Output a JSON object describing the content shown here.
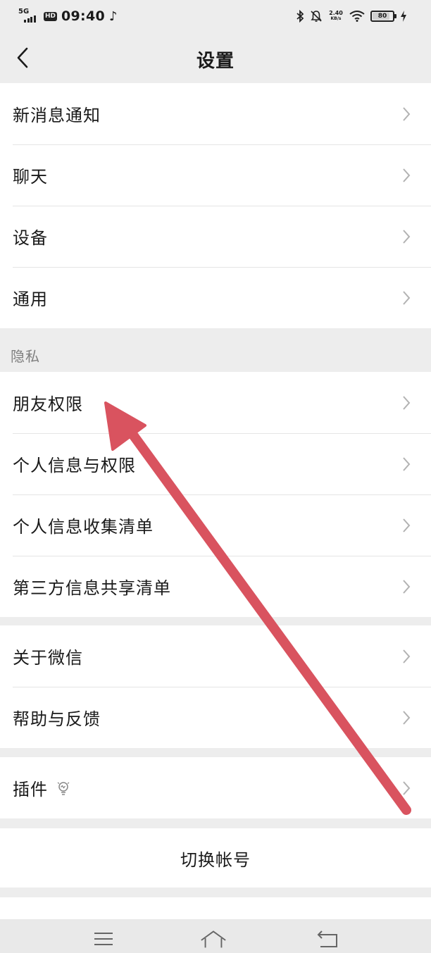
{
  "status_bar": {
    "network": "5G",
    "hd": "HD",
    "time": "09:40",
    "tiktok_glyph": "♪",
    "speed_value": "2.40",
    "speed_unit": "KB/s",
    "battery": "80",
    "icons": [
      "signal-icon",
      "tiktok-icon",
      "bluetooth-icon",
      "mute-bell-icon",
      "wifi-icon",
      "battery-icon",
      "charging-icon"
    ]
  },
  "header": {
    "title": "设置"
  },
  "groups": {
    "main": [
      {
        "label": "新消息通知"
      },
      {
        "label": "聊天"
      },
      {
        "label": "设备"
      },
      {
        "label": "通用"
      }
    ],
    "privacy_header": "隐私",
    "privacy": [
      {
        "label": "朋友权限"
      },
      {
        "label": "个人信息与权限"
      },
      {
        "label": "个人信息收集清单"
      },
      {
        "label": "第三方信息共享清单"
      }
    ],
    "about": [
      {
        "label": "关于微信"
      },
      {
        "label": "帮助与反馈"
      }
    ],
    "plugins": [
      {
        "label": "插件"
      }
    ]
  },
  "switch_account": "切换帐号",
  "annotation": {
    "color": "#d9535f"
  },
  "colors": {
    "background": "#ededed",
    "cell": "#ffffff",
    "divider": "#e5e5e5",
    "secondary_text": "#7f7f7f",
    "chevron": "#b2b2b2"
  }
}
